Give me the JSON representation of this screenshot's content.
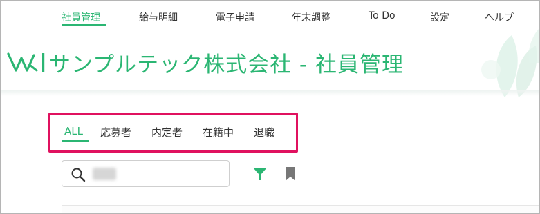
{
  "nav": {
    "items": [
      {
        "label": "社員管理",
        "active": true
      },
      {
        "label": "給与明細",
        "active": false
      },
      {
        "label": "電子申請",
        "active": false
      },
      {
        "label": "年末調整",
        "active": false
      },
      {
        "label": "To Do",
        "active": false
      },
      {
        "label": "設定",
        "active": false
      },
      {
        "label": "ヘルプ",
        "active": false
      }
    ]
  },
  "header": {
    "title": "サンプルテック株式会社 - 社員管理",
    "logo_icon": "wa-logo-icon"
  },
  "tabs": [
    {
      "label": "ALL",
      "active": true
    },
    {
      "label": "応募者",
      "active": false
    },
    {
      "label": "内定者",
      "active": false
    },
    {
      "label": "在籍中",
      "active": false
    },
    {
      "label": "退職",
      "active": false
    }
  ],
  "search": {
    "icon": "search-icon",
    "value": ""
  },
  "toolbar": {
    "filter_icon": "filter-icon",
    "bookmark_icon": "bookmark-icon"
  },
  "colors": {
    "accent": "#2bb673",
    "highlight_box": "#e0115f",
    "icon_gray": "#777777"
  }
}
